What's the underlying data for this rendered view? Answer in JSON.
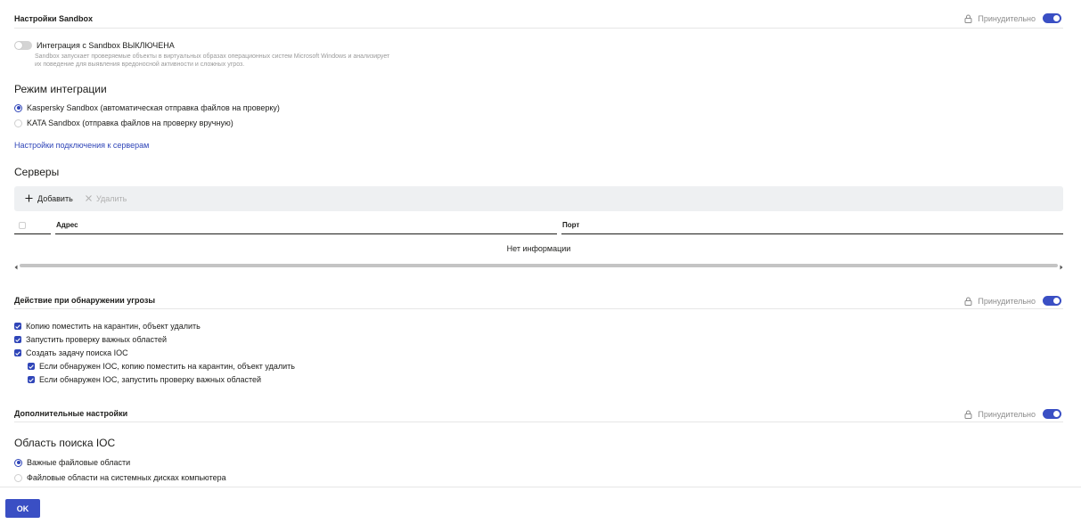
{
  "sandbox_settings": {
    "title": "Настройки Sandbox",
    "lock_label": "Принудительно",
    "toggle_label": "Интеграция с Sandbox ВЫКЛЮЧЕНА",
    "toggle_enabled": false,
    "description_line1": "Sandbox запускает проверяемые объекты в виртуальных образах операционных систем Microsoft Windows и анализирует",
    "description_line2": "их поведение для выявления вредоносной активности и сложных угроз."
  },
  "integration_mode": {
    "title": "Режим интеграции",
    "options": [
      {
        "label": "Kaspersky Sandbox (автоматическая отправка файлов на проверку)",
        "selected": true
      },
      {
        "label": "KATA Sandbox (отправка файлов на проверку вручную)",
        "selected": false
      }
    ],
    "connection_link": "Настройки подключения к серверам"
  },
  "servers": {
    "title": "Серверы",
    "add_label": "Добавить",
    "delete_label": "Удалить",
    "columns": [
      "Адрес",
      "Порт"
    ],
    "empty_message": "Нет информации"
  },
  "threat_action": {
    "title": "Действие при обнаружении угрозы",
    "lock_label": "Принудительно",
    "checkboxes": [
      {
        "label": "Копию поместить на карантин, объект удалить",
        "checked": true
      },
      {
        "label": "Запустить проверку важных областей",
        "checked": true
      },
      {
        "label": "Создать задачу поиска IOC",
        "checked": true
      },
      {
        "label": "Если обнаружен IOC, копию поместить на карантин, объект удалить",
        "checked": true
      },
      {
        "label": "Если обнаружен IOC, запустить проверку важных областей",
        "checked": true
      }
    ]
  },
  "additional": {
    "title": "Дополнительные настройки",
    "lock_label": "Принудительно"
  },
  "ioc_scope": {
    "title": "Область поиска IOC",
    "options": [
      {
        "label": "Важные файловые области",
        "selected": true
      },
      {
        "label": "Файловые области на системных дисках компьютера",
        "selected": false
      }
    ]
  },
  "footer": {
    "ok_label": "OK"
  },
  "colors": {
    "accent": "#3a4fc4",
    "text": "#1d1d1b",
    "muted": "#8c8c8c"
  }
}
